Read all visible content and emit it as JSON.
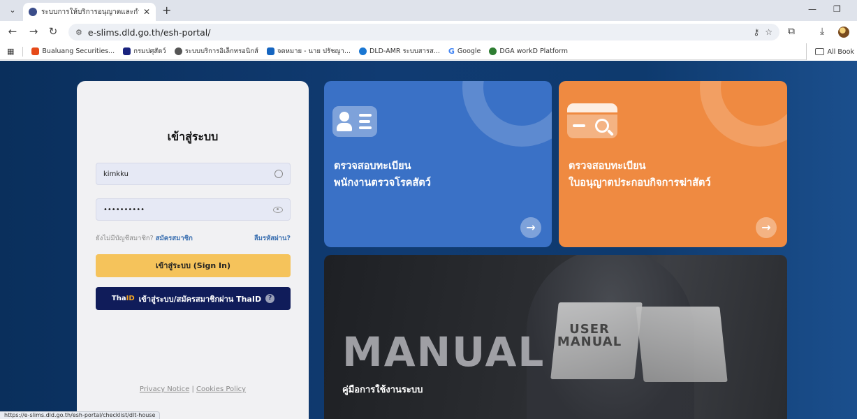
{
  "browser": {
    "tab_title": "ระบบการให้บริการอนุญาตและกำกับดู",
    "url": "e-slims.dld.go.th/esh-portal/",
    "bookmarks": [
      {
        "label": "Bualuang Securities...",
        "color": "#e64a19"
      },
      {
        "label": "กรมปศุสัตว์",
        "color": "#1a237e"
      },
      {
        "label": "ระบบบริการอิเล็กทรอนิกส์",
        "color": "#555555"
      },
      {
        "label": "จดหมาย - นาย ปรัชญา...",
        "color": "#1565c0"
      },
      {
        "label": "DLD-AMR ระบบสารส...",
        "color": "#1976d2"
      },
      {
        "label": "Google",
        "color": "#4285f4"
      },
      {
        "label": "DGA workD Platform",
        "color": "#2e7d32"
      }
    ],
    "all_bookmarks_label": "All Book",
    "status_url": "https://e-slims.dld.go.th/esh-portal/checklist/dlt-house"
  },
  "login": {
    "title": "เข้าสู่ระบบ",
    "username_value": "kimkku",
    "password_value": "••••••••••",
    "no_account_text": "ยังไม่มีบัญชีสมาชิก?",
    "register_link": "สมัครสมาชิก",
    "forgot_link": "ลืมรหัสผ่าน?",
    "signin_label": "เข้าสู่ระบบ (Sign In)",
    "thaid_logo_a": "Tha",
    "thaid_logo_b": "ID",
    "thaid_label": "เข้าสู่ระบบ/สมัครสมาชิกผ่าน ThaID",
    "privacy_label": "Privacy Notice",
    "separator": "|",
    "cookies_label": "Cookies Policy"
  },
  "cards": {
    "vet": {
      "line1": "ตรวจสอบทะเบียน",
      "line2": "พนักงานตรวจโรคสัตว์",
      "color": "#3a71c6"
    },
    "license": {
      "line1": "ตรวจสอบทะเบียน",
      "line2": "ใบอนุญาตประกอบกิจการฆ่าสัตว์",
      "color": "#ef8a41"
    },
    "manual": {
      "big_text": "MANUAL",
      "book_text": "USER MANUAL",
      "subtitle": "คู่มือการใช้งานระบบ"
    }
  }
}
